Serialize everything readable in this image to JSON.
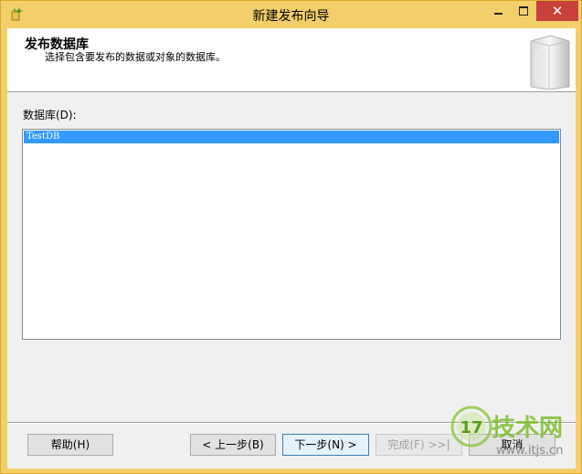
{
  "window": {
    "title": "新建发布向导",
    "close_glyph": "✕",
    "icon": "wizard-star-icon"
  },
  "header": {
    "title": "发布数据库",
    "description": "选择包含要发布的数据或对象的数据库。",
    "graphic": "database-cylinder-icon"
  },
  "databases": {
    "label": "数据库(D):",
    "items": [
      {
        "name": "TestDB",
        "selected": true
      }
    ]
  },
  "buttons": {
    "help": "帮助(H)",
    "back": "< 上一步(B)",
    "next": "下一步(N) >",
    "finish": "完成(F) >>|",
    "cancel": "取消"
  },
  "watermark": {
    "text": "技术网",
    "url": "www.itjs.cn",
    "badge": "17"
  },
  "colors": {
    "title_bar": "#f2cf6a",
    "close_button": "#c7403a",
    "selection": "#3399ff",
    "watermark_green": "#7bbf2e"
  }
}
